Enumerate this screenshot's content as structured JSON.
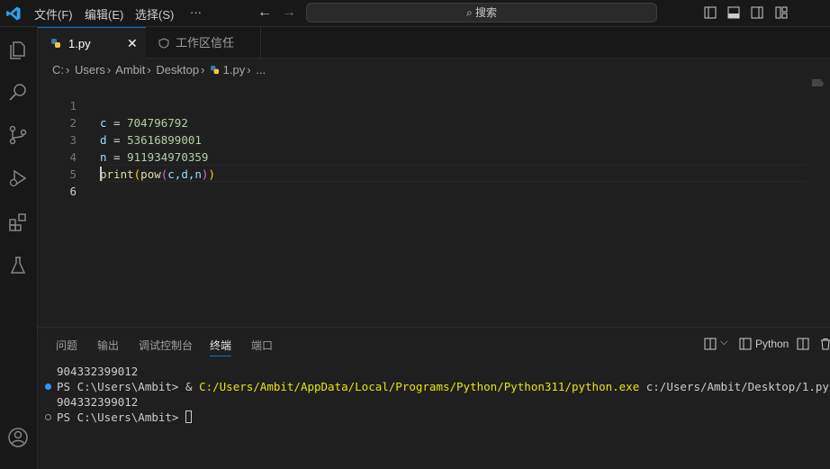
{
  "menu": {
    "file": "文件(F)",
    "edit": "编辑(E)",
    "selection": "选择(S)",
    "more": "···"
  },
  "search": {
    "label": "搜索"
  },
  "tabs": [
    {
      "label": "1.py"
    },
    {
      "label": "工作区信任"
    }
  ],
  "breadcrumb": {
    "drive": "C:",
    "users": "Users",
    "user": "Ambit",
    "desktop": "Desktop",
    "file": "1.py",
    "more": "..."
  },
  "editor": {
    "line_numbers": [
      "1",
      "2",
      "3",
      "4",
      "5",
      "6"
    ],
    "lines": [
      {
        "var": "c",
        "op": " = ",
        "val": "704796792"
      },
      {
        "var": "d",
        "op": " = ",
        "val": "53616899001"
      },
      {
        "var": "n",
        "op": " = ",
        "val": "911934970359"
      },
      {
        "fn": "print",
        "inner": "pow",
        "args": "c,d,n"
      }
    ]
  },
  "panel": {
    "tabs": [
      "问题",
      "输出",
      "调试控制台",
      "终端",
      "端口"
    ],
    "active_tab": "终端",
    "profile": "Python"
  },
  "terminal": {
    "line1": "904332399012",
    "line2_prompt": "PS C:\\Users\\Ambit> ",
    "line2_amp": "& ",
    "line2_exe": "C:/Users/Ambit/AppData/Local/Programs/Python/Python311/python.exe",
    "line2_arg": " c:/Users/Ambit/Desktop/1.py",
    "line3": "904332399012",
    "line4_prompt": "PS C:\\Users\\Ambit> "
  },
  "colors": {
    "accent": "#0078d4",
    "number": "#b5cea8",
    "function": "#dcdcaa",
    "variable": "#9cdcfe",
    "paren1": "#ffd700",
    "paren2": "#da70d6"
  }
}
